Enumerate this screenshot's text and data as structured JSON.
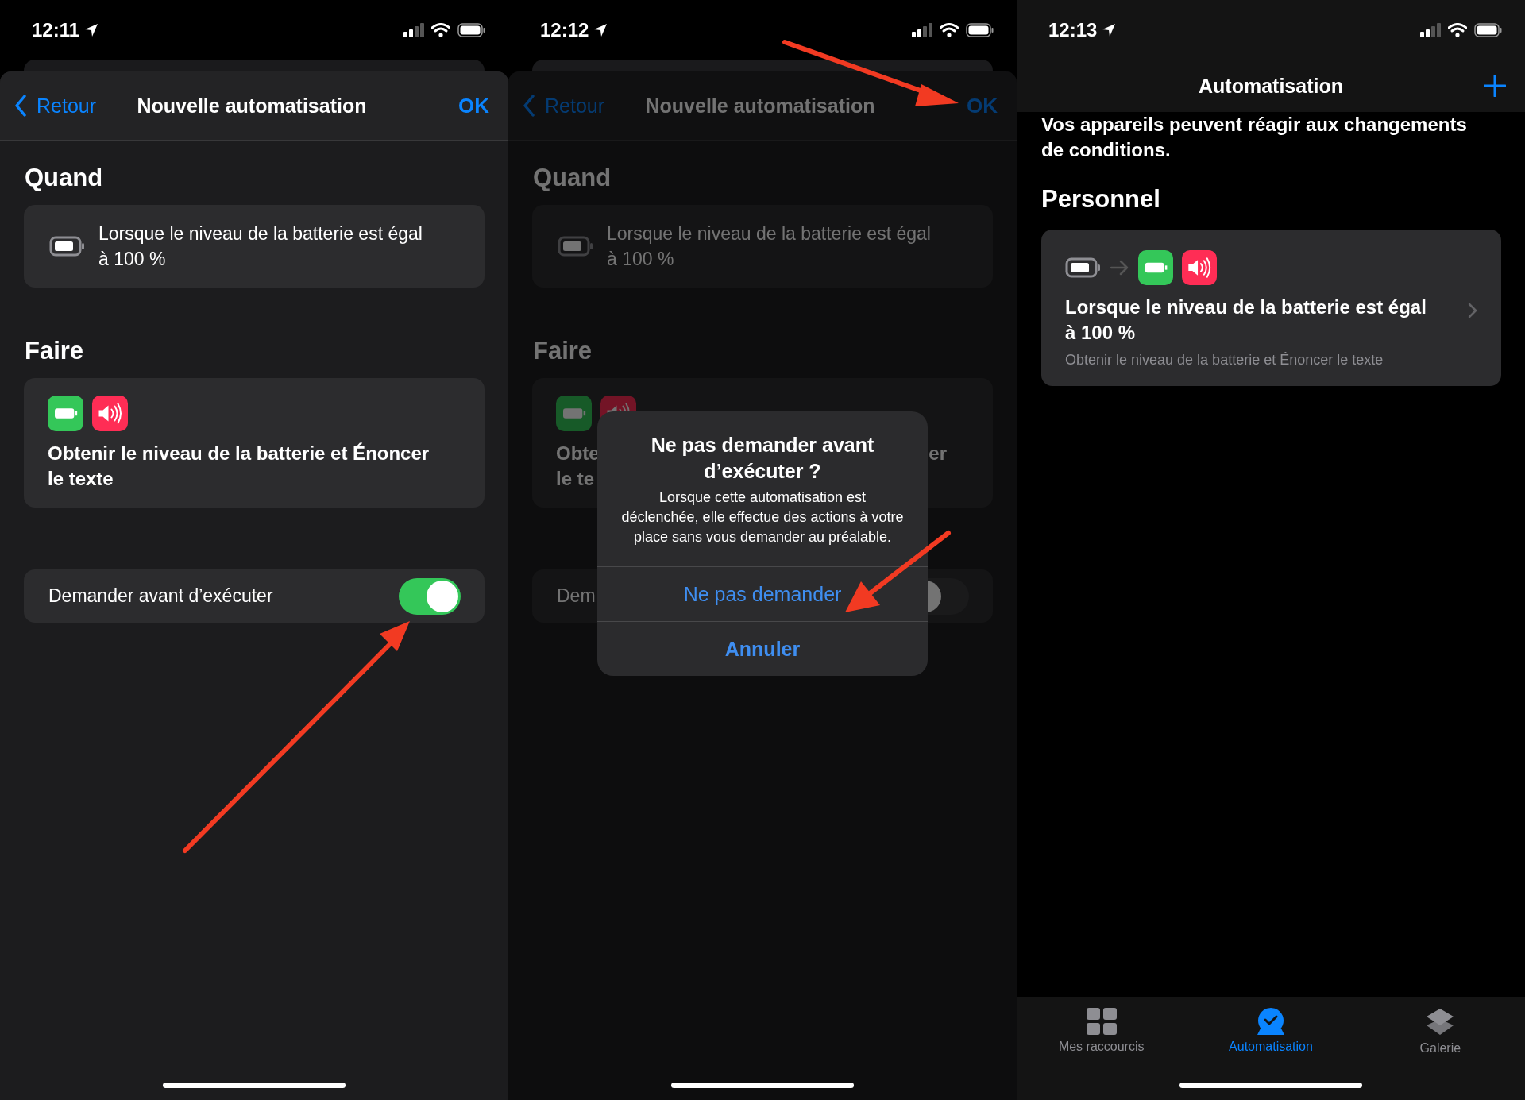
{
  "panels": [
    {
      "kind": "sheet",
      "dimmed": false,
      "status": {
        "time": "12:11"
      },
      "nav": {
        "back": "Retour",
        "title": "Nouvelle automatisation",
        "done": "OK"
      },
      "sections": [
        {
          "heading": "Quand",
          "card": {
            "kind": "trigger",
            "lines": [
              "Lorsque le niveau de la batterie est égal",
              "à 100 %"
            ]
          }
        },
        {
          "heading": "Faire",
          "card": {
            "kind": "actions",
            "lines": [
              "Obtenir le niveau de la batterie et Énoncer",
              "le texte"
            ]
          }
        }
      ],
      "toggle": {
        "label": "Demander avant d’exécuter",
        "on": true
      }
    },
    {
      "kind": "sheet",
      "dimmed": true,
      "status": {
        "time": "12:12"
      },
      "nav": {
        "back": "Retour",
        "title": "Nouvelle automatisation",
        "done": "OK"
      },
      "sections": [
        {
          "heading": "Quand",
          "card": {
            "kind": "trigger",
            "lines": [
              "Lorsque le niveau de la batterie est égal",
              "à 100 %"
            ]
          }
        },
        {
          "heading": "Faire",
          "card": {
            "kind": "actions",
            "fragments": [
              [
                "Obte",
                "er"
              ],
              [
                "le te"
              ]
            ]
          }
        }
      ],
      "toggle": {
        "label": "Dem",
        "on": false
      },
      "dialog": {
        "title": "Ne pas demander avant d’exécuter ?",
        "message": "Lorsque cette automatisation est déclenchée, elle effectue des actions à votre place sans vous demander au préalable.",
        "buttons": [
          {
            "label": "Ne pas demander",
            "kind": "default"
          },
          {
            "label": "Annuler",
            "kind": "cancel"
          }
        ]
      }
    },
    {
      "kind": "list",
      "status": {
        "time": "12:13"
      },
      "nav": {
        "title": "Automatisation"
      },
      "intro": [
        "Vos appareils peuvent réagir aux changements",
        "de conditions."
      ],
      "heading": "Personnel",
      "automations": [
        {
          "title": [
            "Lorsque le niveau de la batterie est égal",
            "à 100 %"
          ],
          "subtitle": "Obtenir le niveau de la batterie et Énoncer le texte"
        }
      ],
      "tabs": [
        {
          "label": "Mes raccourcis",
          "kind": "shortcuts",
          "selected": false
        },
        {
          "label": "Automatisation",
          "kind": "automation",
          "selected": true
        },
        {
          "label": "Galerie",
          "kind": "gallery",
          "selected": false
        }
      ]
    }
  ]
}
